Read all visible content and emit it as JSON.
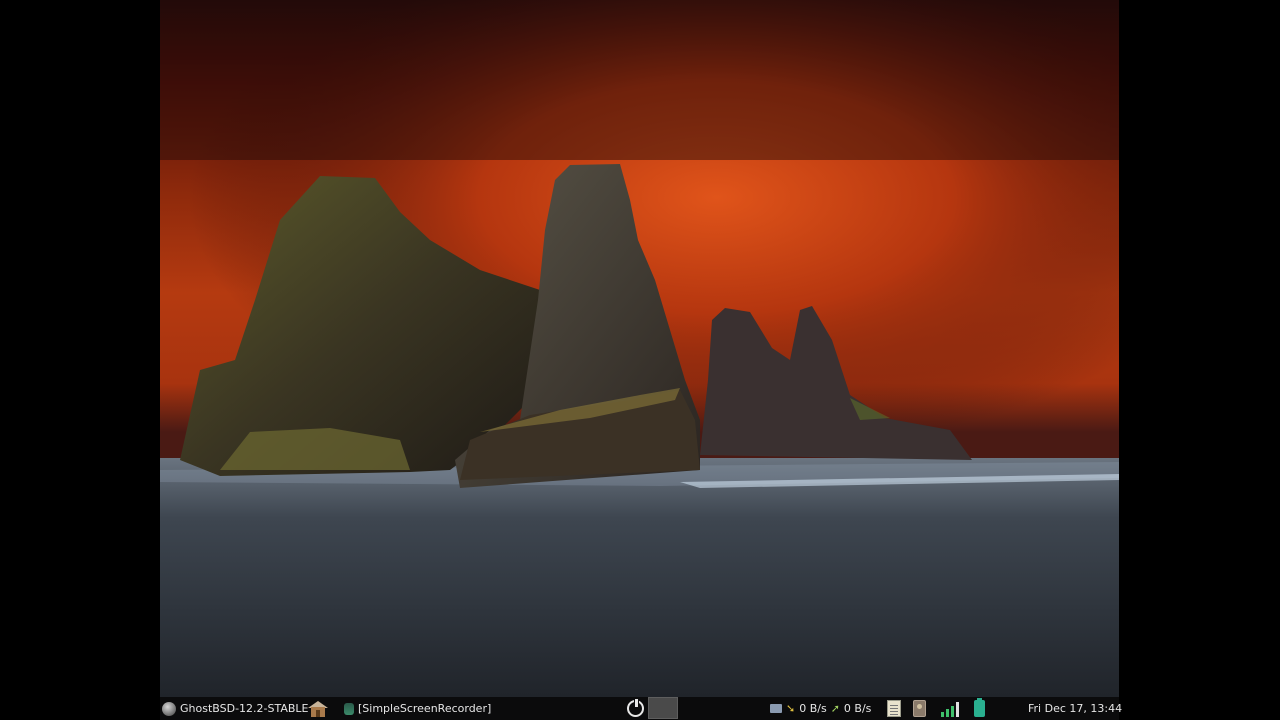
{
  "taskbar": {
    "menu_label": "GhostBSD-12.2-STABLE",
    "task_title": "[SimpleScreenRecorder]",
    "net_down": "0 B/s",
    "net_up": "0 B/s",
    "clock": "Fri Dec 17, 13:44"
  },
  "icons": {
    "menu": "ghostbsd-menu-icon",
    "home": "home-folder-icon",
    "task": "screen-recorder-icon",
    "power": "power-icon",
    "network": "network-icon",
    "notes": "notes-icon",
    "device": "removable-device-icon",
    "signal": "wifi-signal-icon",
    "battery": "battery-icon"
  },
  "colors": {
    "taskbar_bg": "#0b0b0c",
    "sky_red": "#b53a10",
    "signal_green": "#3ec06a",
    "battery_teal": "#2ab090"
  }
}
